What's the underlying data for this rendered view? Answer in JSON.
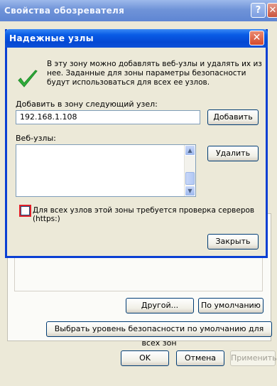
{
  "parent_window": {
    "title": "Свойства обозревателя",
    "help_button": "?",
    "close_button": "✕",
    "buttons": {
      "other": "Другой...",
      "default": "По умолчанию",
      "reset_all": "Выбрать уровень безопасности по умолчанию для всех зон",
      "ok": "OK",
      "cancel": "Отмена",
      "apply": "Применить"
    }
  },
  "dialog": {
    "title": "Надежные узлы",
    "close_button": "✕",
    "intro_text": "В эту зону можно добавлять веб-узлы и удалять их из нее. Заданные для зоны параметры безопасности будут использоваться для всех ее узлов.",
    "add_label": "Добавить в зону следующий узел:",
    "add_input_value": "192.168.1.108",
    "add_button": "Добавить",
    "sites_label": "Веб-узлы:",
    "sites": [],
    "remove_button": "Удалить",
    "https_checkbox": {
      "label": "Для всех узлов этой зоны требуется проверка серверов (https:)",
      "checked": false
    },
    "close_dialog_button": "Закрыть"
  },
  "colors": {
    "dialog_titlebar": "#0a5ce6",
    "parent_titlebar": "#6f93d8",
    "highlight": "#e0202a",
    "check_green": "#2fae3a"
  }
}
